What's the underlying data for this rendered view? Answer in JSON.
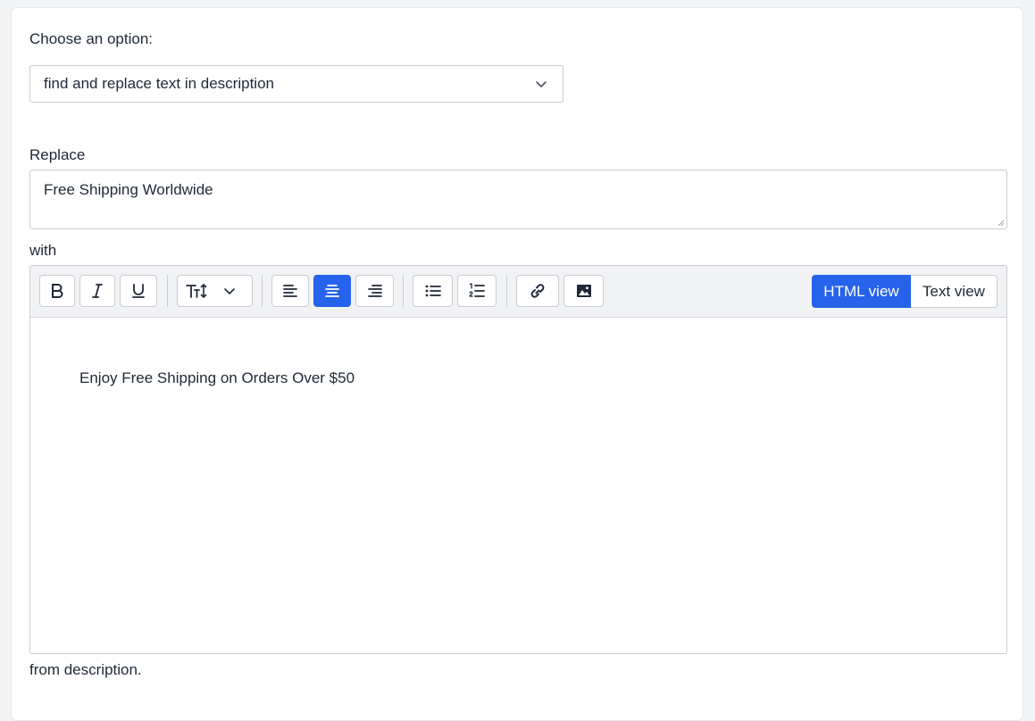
{
  "form": {
    "choose_label": "Choose an option:",
    "select_value": "find and replace text in description",
    "replace_label": "Replace",
    "replace_value": "Free Shipping Worldwide",
    "with_label": "with",
    "footer_text": "from description."
  },
  "toolbar": {
    "bold_icon": "bold-icon",
    "italic_icon": "italic-icon",
    "underline_icon": "underline-icon",
    "text_size_icon": "text-size-icon",
    "align_left_icon": "align-left-icon",
    "align_center_icon": "align-center-icon",
    "align_right_icon": "align-right-icon",
    "bullet_list_icon": "bullet-list-icon",
    "numbered_list_icon": "numbered-list-icon",
    "link_icon": "link-icon",
    "image_icon": "image-icon",
    "active_alignment": "center",
    "html_view_label": "HTML view",
    "text_view_label": "Text view",
    "active_view": "HTML view"
  },
  "editor": {
    "content": "Enjoy Free Shipping on Orders Over $50"
  },
  "colors": {
    "accent": "#2563eb",
    "border": "#c9ccd1",
    "toolbar_bg": "#f1f2f4",
    "page_bg": "#f3f4f6"
  }
}
